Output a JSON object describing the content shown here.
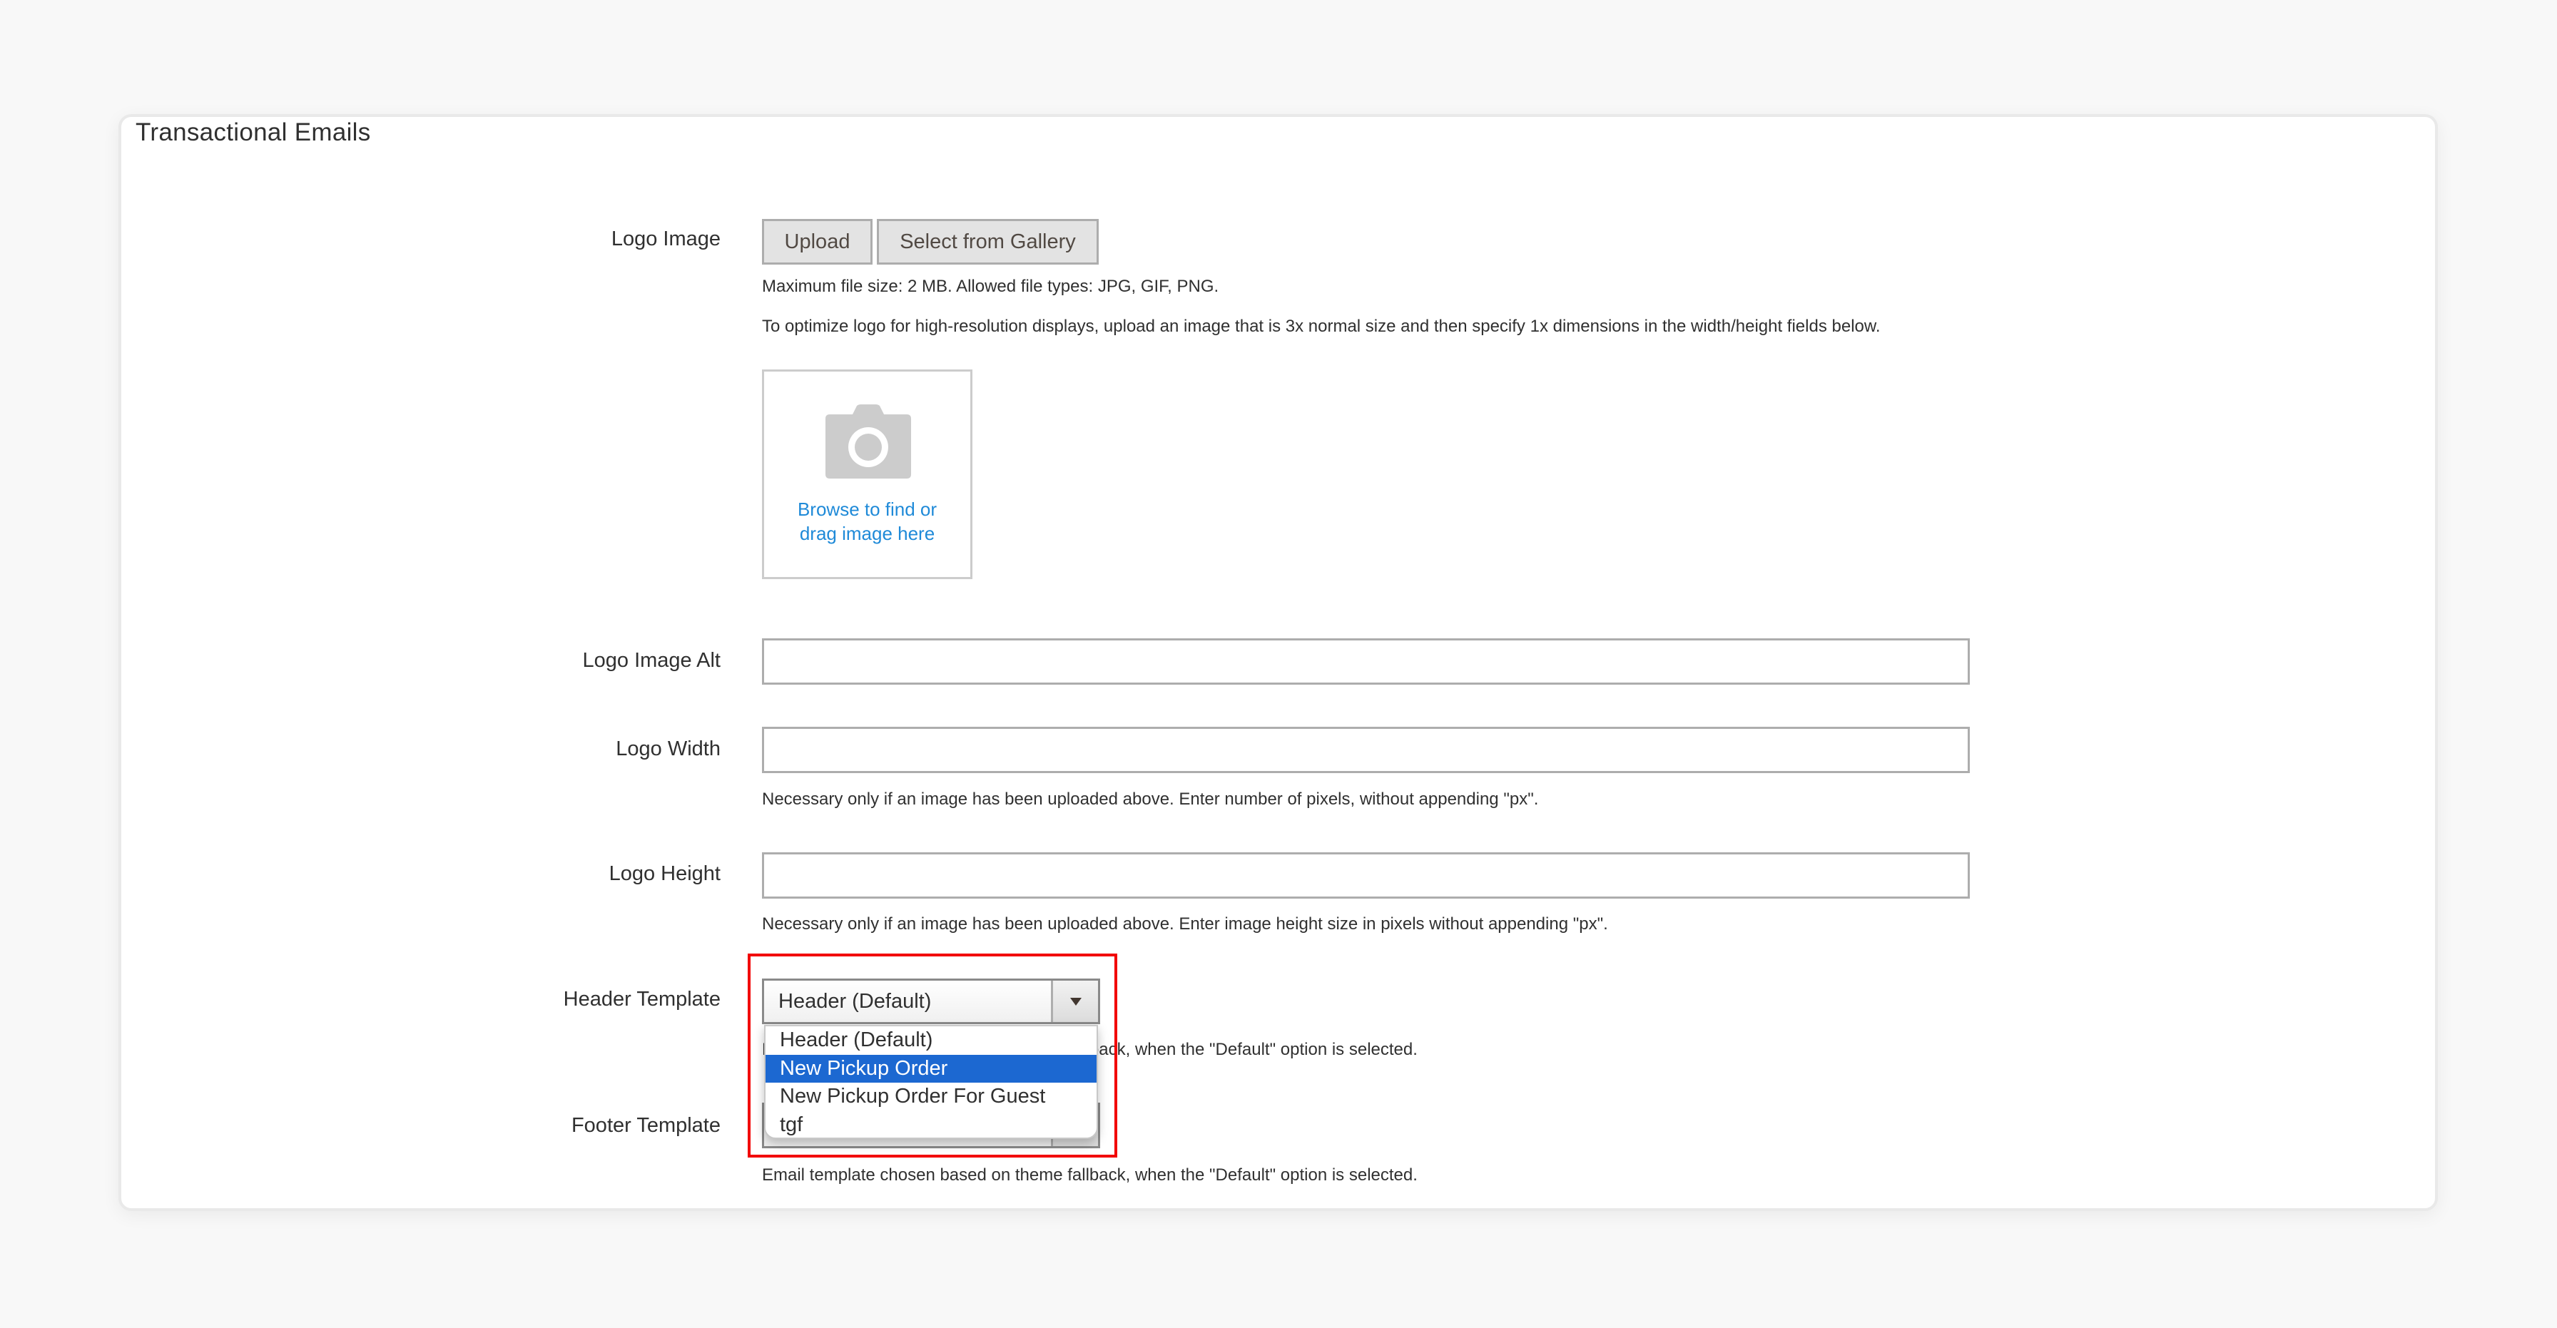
{
  "section": {
    "title": "Transactional Emails"
  },
  "logo_image": {
    "label": "Logo Image",
    "upload_button": "Upload",
    "gallery_button": "Select from Gallery",
    "note_size": "Maximum file size: 2 MB. Allowed file types: JPG, GIF, PNG.",
    "note_resolution": "To optimize logo for high-resolution displays, upload an image that is 3x normal size and then specify 1x dimensions in the width/height fields below.",
    "dropzone_icon": "camera-icon",
    "dropzone_text": "Browse to find or drag image here"
  },
  "logo_alt": {
    "label": "Logo Image Alt",
    "value": "",
    "placeholder": ""
  },
  "logo_width": {
    "label": "Logo Width",
    "value": "",
    "placeholder": "",
    "note": "Necessary only if an image has been uploaded above. Enter number of pixels, without appending \"px\"."
  },
  "logo_height": {
    "label": "Logo Height",
    "value": "",
    "placeholder": "",
    "note": "Necessary only if an image has been uploaded above. Enter image height size in pixels without appending \"px\"."
  },
  "header_template": {
    "label": "Header Template",
    "selected": "Header (Default)",
    "note": "Email template chosen based on theme fallback, when the \"Default\" option is selected.",
    "dropdown_open": true,
    "highlighted_option": "New Pickup Order",
    "options": [
      {
        "label": "Header (Default)"
      },
      {
        "label": "New Pickup Order"
      },
      {
        "label": "New Pickup Order For Guest"
      },
      {
        "label": "tgf"
      }
    ]
  },
  "footer_template": {
    "label": "Footer Template",
    "selected": "",
    "note": "Email template chosen based on theme fallback, when the \"Default\" option is selected."
  },
  "colors": {
    "link": "#1f8ad8",
    "highlight_option": "#1c68d1",
    "annotation_box": "#f20000"
  }
}
